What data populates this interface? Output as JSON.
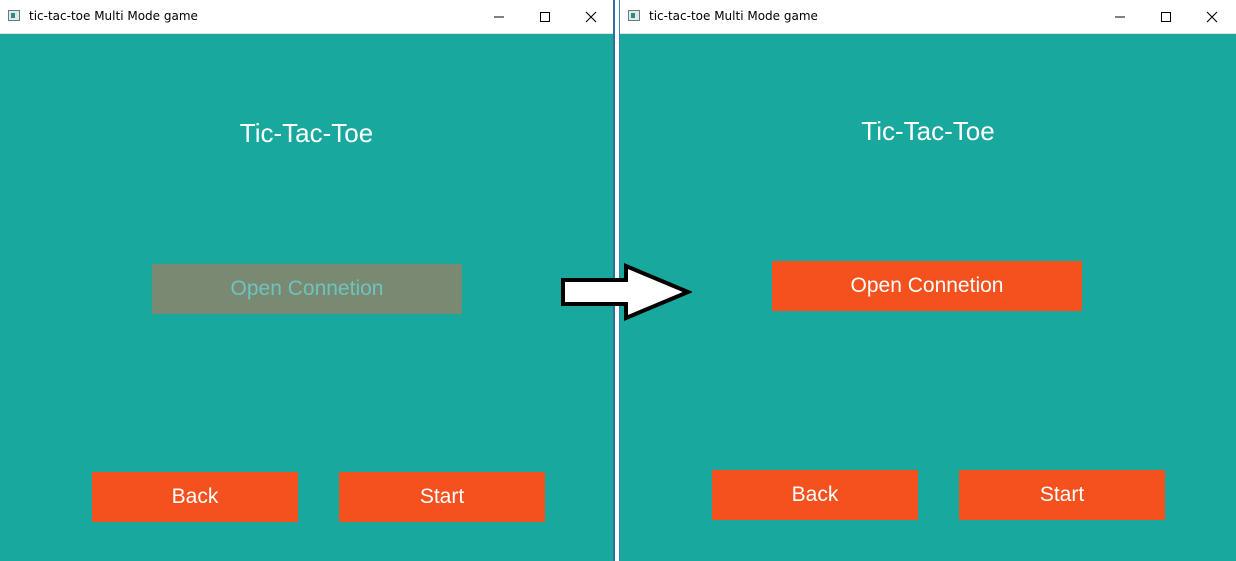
{
  "left_window": {
    "title": "tic-tac-toe Multi Mode game",
    "game_title": "Tic-Tac-Toe",
    "open_connection_label": "Open Connetion",
    "back_label": "Back",
    "start_label": "Start"
  },
  "right_window": {
    "title": "tic-tac-toe Multi Mode game",
    "game_title": "Tic-Tac-Toe",
    "open_connection_label": "Open Connetion",
    "back_label": "Back",
    "start_label": "Start"
  },
  "colors": {
    "background": "#19a89d",
    "button": "#f4511e",
    "button_disabled": "#7a8a72",
    "disabled_text": "#6ec3c0"
  },
  "icons": {
    "app": "app-icon",
    "minimize": "minimize-icon",
    "maximize": "maximize-icon",
    "close": "close-icon",
    "transition": "right-arrow-icon"
  }
}
